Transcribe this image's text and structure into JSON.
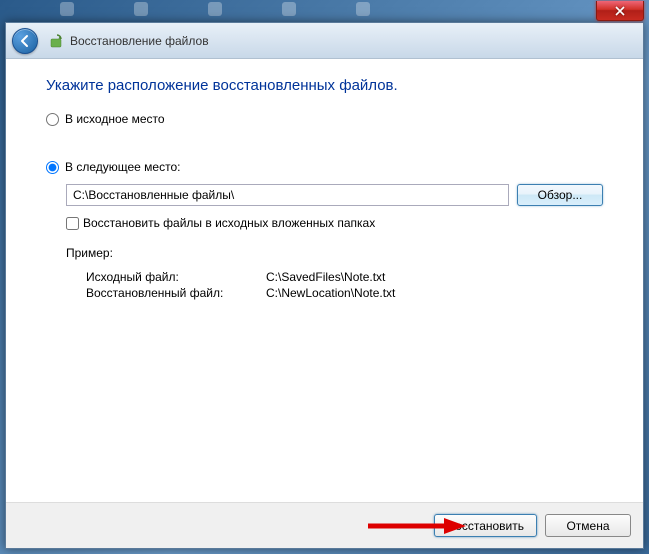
{
  "window": {
    "title": "Восстановление файлов"
  },
  "heading": "Укажите расположение восстановленных файлов.",
  "radios": {
    "original": "В исходное место",
    "custom": "В следующее место:"
  },
  "path": {
    "value": "C:\\Восстановленные файлы\\",
    "browse": "Обзор..."
  },
  "checkbox": {
    "label": "Восстановить файлы в исходных вложенных папках"
  },
  "example": {
    "title": "Пример:",
    "source_label": "Исходный файл:",
    "source_value": "C:\\SavedFiles\\Note.txt",
    "restored_label": "Восстановленный файл:",
    "restored_value": "C:\\NewLocation\\Note.txt"
  },
  "buttons": {
    "restore": "Восстановить",
    "cancel": "Отмена"
  }
}
